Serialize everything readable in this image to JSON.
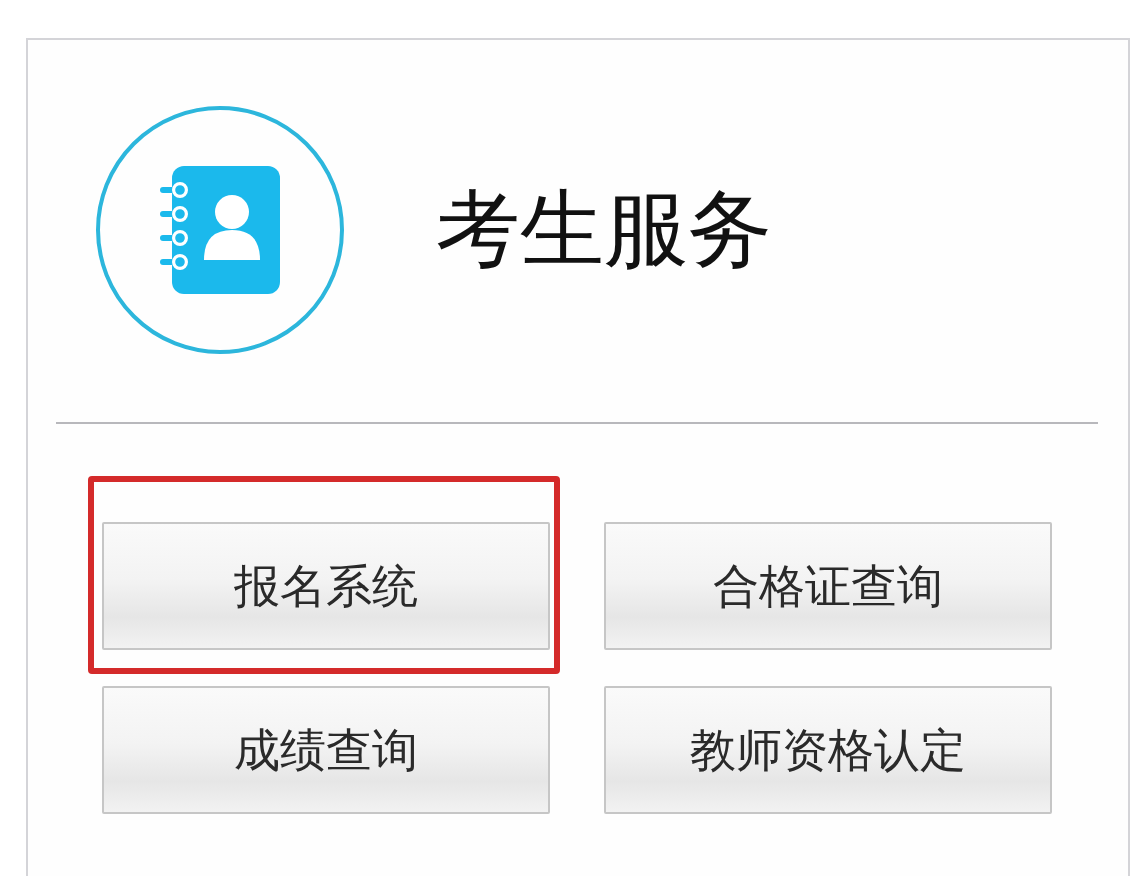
{
  "header": {
    "title": "考生服务"
  },
  "buttons": [
    {
      "label": "报名系统",
      "highlighted": true
    },
    {
      "label": "合格证查询",
      "highlighted": false
    },
    {
      "label": "成绩查询",
      "highlighted": false
    },
    {
      "label": "教师资格认定",
      "highlighted": false
    }
  ]
}
